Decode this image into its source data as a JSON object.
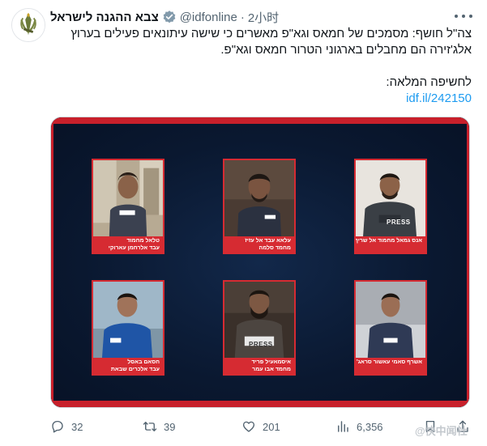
{
  "author": {
    "display_name": "צבא ההגנה לישראל",
    "handle": "@idfonline",
    "separator": "·",
    "time": "2小时"
  },
  "tweet": {
    "line1": "צה\"ל חושף: מסמכים של חמאס וגא\"פ מאשרים כי שישה עיתונאים פעילים בערוץ",
    "line2": "אלג'זירה הם מחבלים בארגוני הטרור חמאס וגא\"פ.",
    "line3": "לחשיפה המלאה:",
    "link": "idf.il/242150"
  },
  "media": {
    "cards": [
      {
        "name": "טלאל מחמוד",
        "role": "עבד אלרחמן עארוקי"
      },
      {
        "name": "עלאא עבד אל עזיז",
        "role": "מחמד סלמה"
      },
      {
        "name": "אנס גמאל מחמוד אל שריף",
        "role": ""
      },
      {
        "name": "חסאם באסל",
        "role": "עבד אלכרים שבאת"
      },
      {
        "name": "איסמאעיל פריד",
        "role": "מחמד אבו עמר"
      },
      {
        "name": "אשרף סאמי עאשור סראג'",
        "role": ""
      }
    ],
    "press_label": "PRESS"
  },
  "actions": {
    "replies": "32",
    "retweets": "39",
    "likes": "201",
    "views": "6,356"
  },
  "watermark": "@快中闻社",
  "colors": {
    "accent": "#1d9bf0",
    "card_red": "#d62b32",
    "media_bg": "#0b1a33"
  }
}
